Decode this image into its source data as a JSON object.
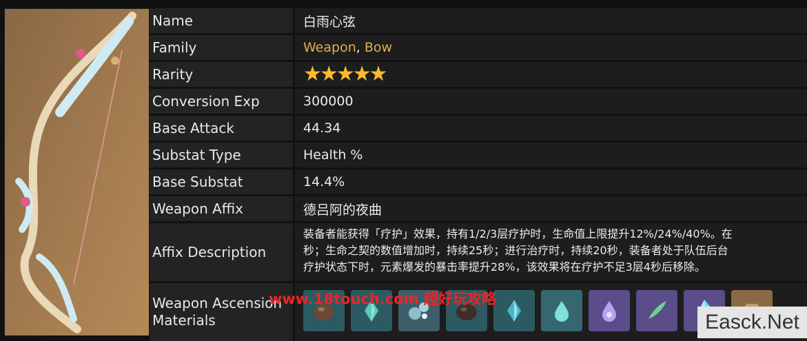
{
  "rows": [
    {
      "label": "Name",
      "value": "白雨心弦"
    },
    {
      "label": "Family",
      "value_parts": [
        "Weapon",
        ", ",
        "Bow"
      ]
    },
    {
      "label": "Rarity",
      "stars": 5
    },
    {
      "label": "Conversion Exp",
      "value": "300000"
    },
    {
      "label": "Base Attack",
      "value": "44.34"
    },
    {
      "label": "Substat Type",
      "value": "Health %"
    },
    {
      "label": "Base Substat",
      "value": "14.4%"
    },
    {
      "label": "Weapon Affix",
      "value": "德吕阿的夜曲"
    },
    {
      "label": "Affix Description",
      "lines": [
        "装备者能获得「疗护」效果，持有1/2/3层疗护时，生命值上限提升12%/24%/40%。在",
        "秒；生命之契的数值增加时，持续25秒；进行治疗时，持续20秒，装备者处于队伍后台",
        "疗护状态下时，元素爆发的暴击率提升28%，该效果将在疗护不足3层4秒后移除。"
      ]
    },
    {
      "label_lines": [
        "Weapon Ascension",
        "Materials"
      ]
    }
  ],
  "star_glyph": "★",
  "materials": [
    {
      "icon": "brown-shell-icon",
      "color": "#2c5a63"
    },
    {
      "icon": "teal-crystal-icon",
      "color": "#2c5a63"
    },
    {
      "icon": "bubble-icon",
      "color": "#3d5f6a"
    },
    {
      "icon": "dark-shell-icon",
      "color": "#2c5a63"
    },
    {
      "icon": "teal-crystal-icon",
      "color": "#2c5a63"
    },
    {
      "icon": "water-drop-icon",
      "color": "#35686e"
    },
    {
      "icon": "purple-drop-icon",
      "color": "#5a4d8a"
    },
    {
      "icon": "green-feather-icon",
      "color": "#5a4d8a"
    },
    {
      "icon": "cyan-crystal-icon",
      "color": "#5a4d8a"
    },
    {
      "icon": "brown-item-icon",
      "color": "#8a6a45"
    }
  ],
  "watermark_18touch": "www.18touch.com 超好玩攻略",
  "watermark_easck": "Easck.Net"
}
